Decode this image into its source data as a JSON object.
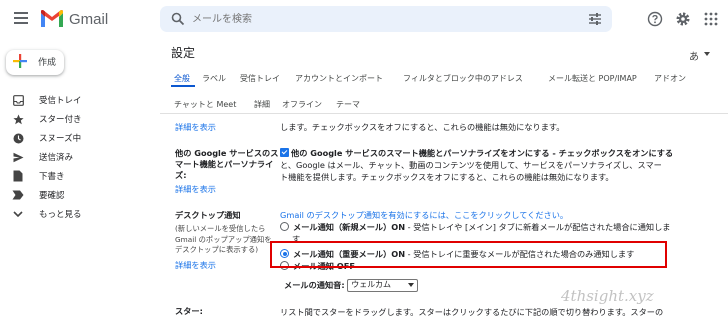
{
  "app": {
    "name": "Gmail"
  },
  "header": {
    "search_placeholder": "メールを検索"
  },
  "sidebar": {
    "compose_label": "作成",
    "items": [
      {
        "label": "受信トレイ",
        "icon": "inbox-icon"
      },
      {
        "label": "スター付き",
        "icon": "star-icon"
      },
      {
        "label": "スヌーズ中",
        "icon": "clock-icon"
      },
      {
        "label": "送信済み",
        "icon": "send-icon"
      },
      {
        "label": "下書き",
        "icon": "draft-icon"
      },
      {
        "label": "要確認",
        "icon": "label-icon"
      },
      {
        "label": "もっと見る",
        "icon": "chevron-down-icon"
      }
    ]
  },
  "settings": {
    "title": "設定",
    "lang_glyph": "あ",
    "tabs_row1": [
      "全般",
      "ラベル",
      "受信トレイ",
      "アカウントとインポート",
      "フィルタとブロック中のアドレス",
      "メール転送と POP/IMAP",
      "アドオン"
    ],
    "tabs_row2": [
      "チャットと Meet",
      "詳細",
      "オフライン",
      "テーマ"
    ],
    "top_link": "詳細を表示",
    "top_text": "します。チェックボックスをオフにすると、これらの機能は無効になります。",
    "smart": {
      "label1": "他の Google サービスのス",
      "label2": "マート機能とパーソナライ",
      "label3": "ズ:",
      "link": "詳細を表示",
      "line1": "他の Google サービスのスマート機能とパーソナライズをオンにする - チェックボックスをオンにする",
      "line2": "と、Google はメール、チャット、動画のコンテンツを使用して、サービスをパーソナライズし、スマー",
      "line3": "ト機能を提供します。チェックボックスをオフにすると、これらの機能は無効になります。"
    },
    "desktop": {
      "label": "デスクトップ通知",
      "note1": "(新しいメールを受信したら",
      "note2": "Gmail のポップアップ通知を",
      "note3": "デスクトップに表示する)",
      "link": "詳細を表示",
      "enable_link": "Gmail のデスクトップ通知を有効にするには、ここをクリックしてください。",
      "opt1_bold": "メール通知（新規メール）ON",
      "opt1_text": " - 受信トレイや [メイン] タブに新着メールが配信された場合に通知しま",
      "opt1_text2": "す",
      "opt2_bold": "メール通知（重要メール）ON",
      "opt2_text": " - 受信トレイに重要なメールが配信された場合のみ通知します",
      "opt3_bold": "メール通知 OFF",
      "sound_label": "メールの通知音:",
      "sound_value": "ウェルカム"
    },
    "stars": {
      "label": "スター:",
      "text": "リスト間でスターをドラッグします。スターはクリックするたびに下記の順で切り替わります。スターの"
    }
  },
  "watermark": "4thsight.xyz"
}
